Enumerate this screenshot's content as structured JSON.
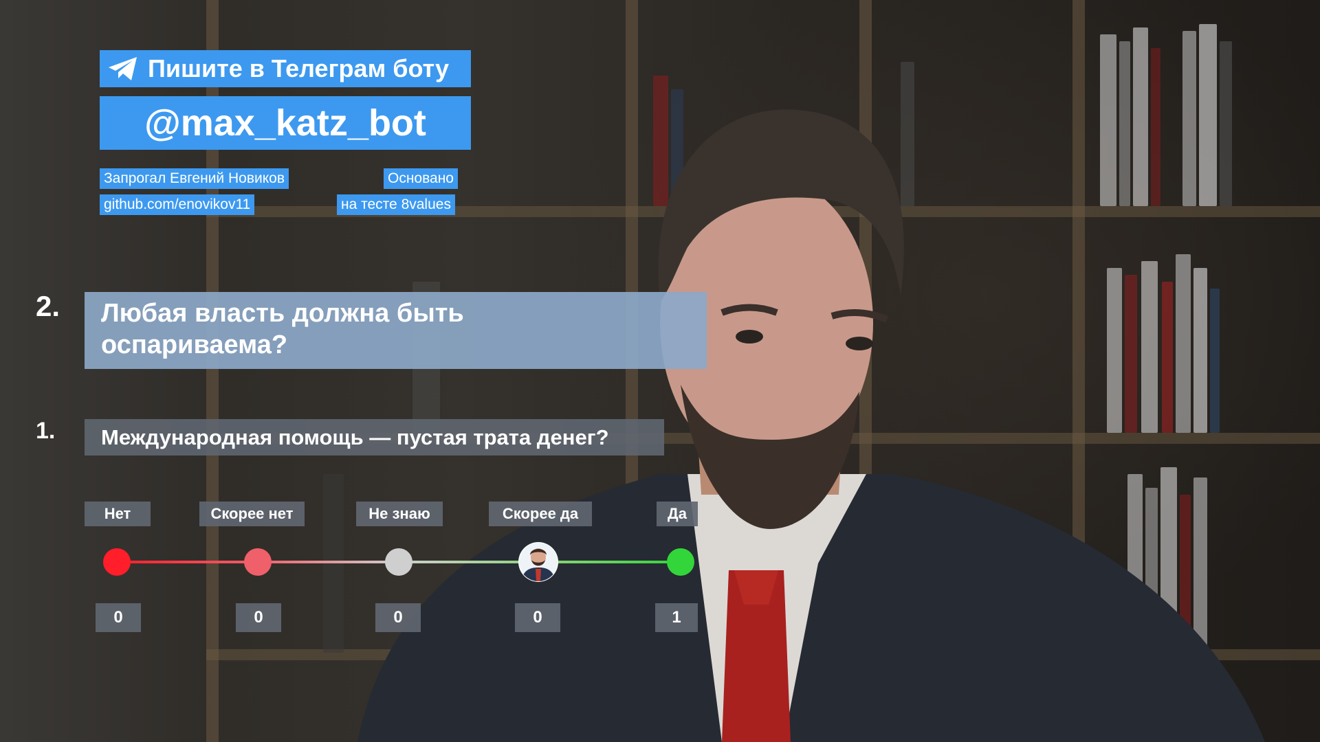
{
  "banner": {
    "text": "Пишите в Телеграм боту",
    "handle": "@max_katz_bot",
    "icon": "telegram-plane-icon"
  },
  "credits": {
    "author": "Запрогал Евгений Новиков",
    "repo": "github.com/enovikov11",
    "based_line1": "Основано",
    "based_line2": "на тесте 8values"
  },
  "questions": [
    {
      "number": "2.",
      "text_line1": "Любая власть должна быть",
      "text_line2": "оспариваема?"
    },
    {
      "number": "1.",
      "text": "Международная помощь — пустая трата денег?"
    }
  ],
  "scale": {
    "options": [
      {
        "label": "Нет",
        "count": "0",
        "color": "#ff1e2a"
      },
      {
        "label": "Скорее нет",
        "count": "0",
        "color": "#f0606a"
      },
      {
        "label": "Не знаю",
        "count": "0",
        "color": "#cfcfcf"
      },
      {
        "label": "Скорее да",
        "count": "0",
        "color": "#8fd37c"
      },
      {
        "label": "Да",
        "count": "1",
        "color": "#33d63a"
      }
    ],
    "marker_option_index": 3,
    "marker_icon": "avatar-icon"
  },
  "colors": {
    "accent": "#3d99ef",
    "question_active": "#8ca8c8",
    "question_inactive": "#5f6670"
  }
}
